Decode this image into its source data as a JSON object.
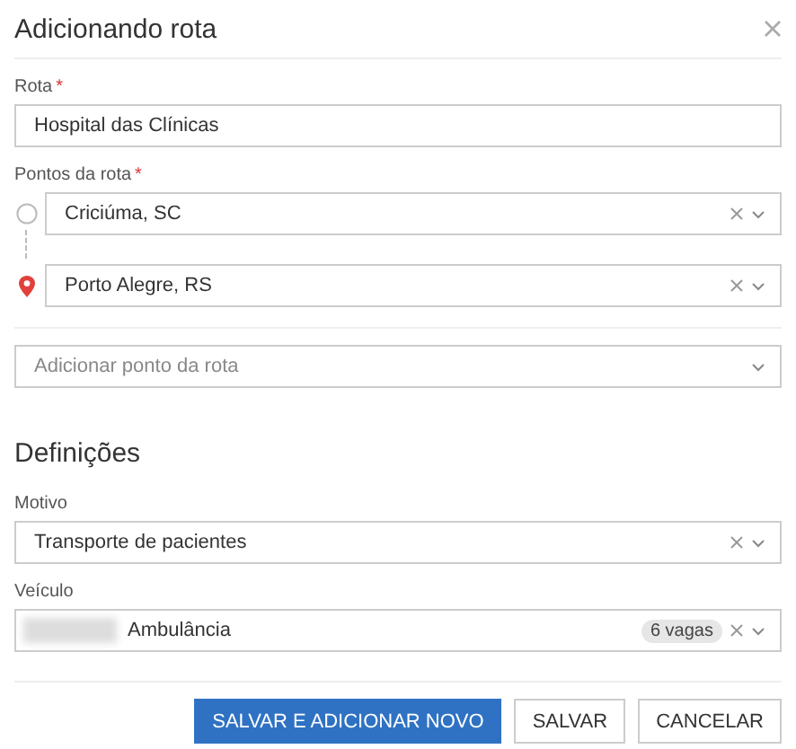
{
  "dialog": {
    "title": "Adicionando rota"
  },
  "route": {
    "label": "Rota",
    "required_mark": "*",
    "value": "Hospital das Clínicas"
  },
  "points": {
    "label": "Pontos da rota",
    "required_mark": "*",
    "items": [
      {
        "kind": "origin",
        "value": "Criciúma, SC"
      },
      {
        "kind": "destination",
        "value": "Porto Alegre, RS"
      }
    ],
    "add_placeholder": "Adicionar ponto da rota"
  },
  "settings": {
    "title": "Definições"
  },
  "reason": {
    "label": "Motivo",
    "value": "Transporte de pacientes"
  },
  "vehicle": {
    "label": "Veículo",
    "value": "Ambulância",
    "badge": "6 vagas"
  },
  "buttons": [
    {
      "label": "SALVAR E ADICIONAR NOVO",
      "primary": true
    },
    {
      "label": "SALVAR",
      "primary": false
    },
    {
      "label": "CANCELAR",
      "primary": false
    }
  ]
}
